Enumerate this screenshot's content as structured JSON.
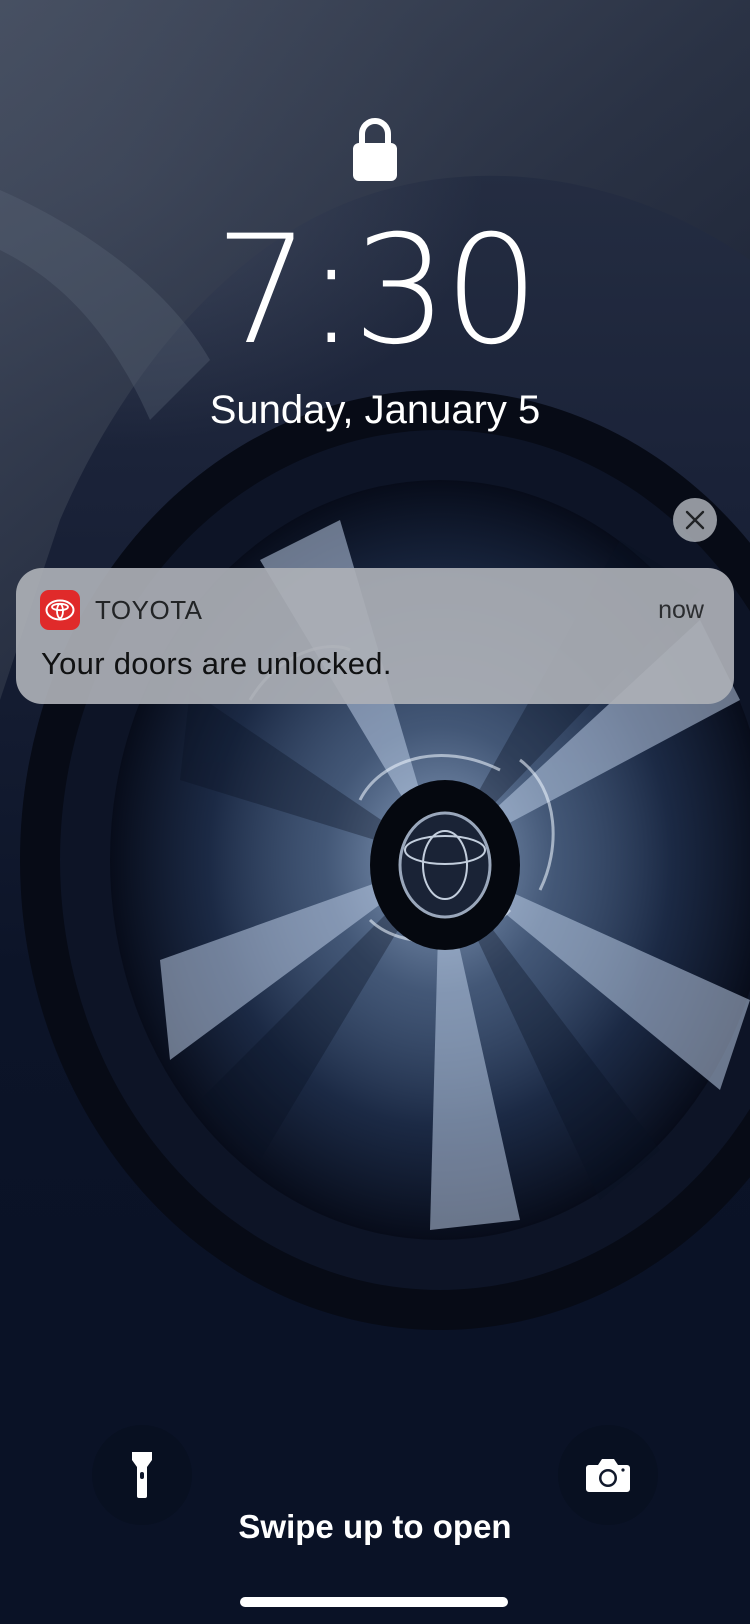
{
  "lock_screen": {
    "time": "7:30",
    "date": "Sunday, January 5",
    "lock_icon": "padlock-icon"
  },
  "notification": {
    "app_name": "TOYOTA",
    "timestamp": "now",
    "message": "Your doors are unlocked.",
    "app_icon": "toyota-logo-icon",
    "app_icon_color": "#e02a2a",
    "dismiss_icon": "close-icon"
  },
  "quick_actions": {
    "flashlight_icon": "flashlight-icon",
    "camera_icon": "camera-icon"
  },
  "footer": {
    "swipe_hint": "Swipe up to open"
  }
}
